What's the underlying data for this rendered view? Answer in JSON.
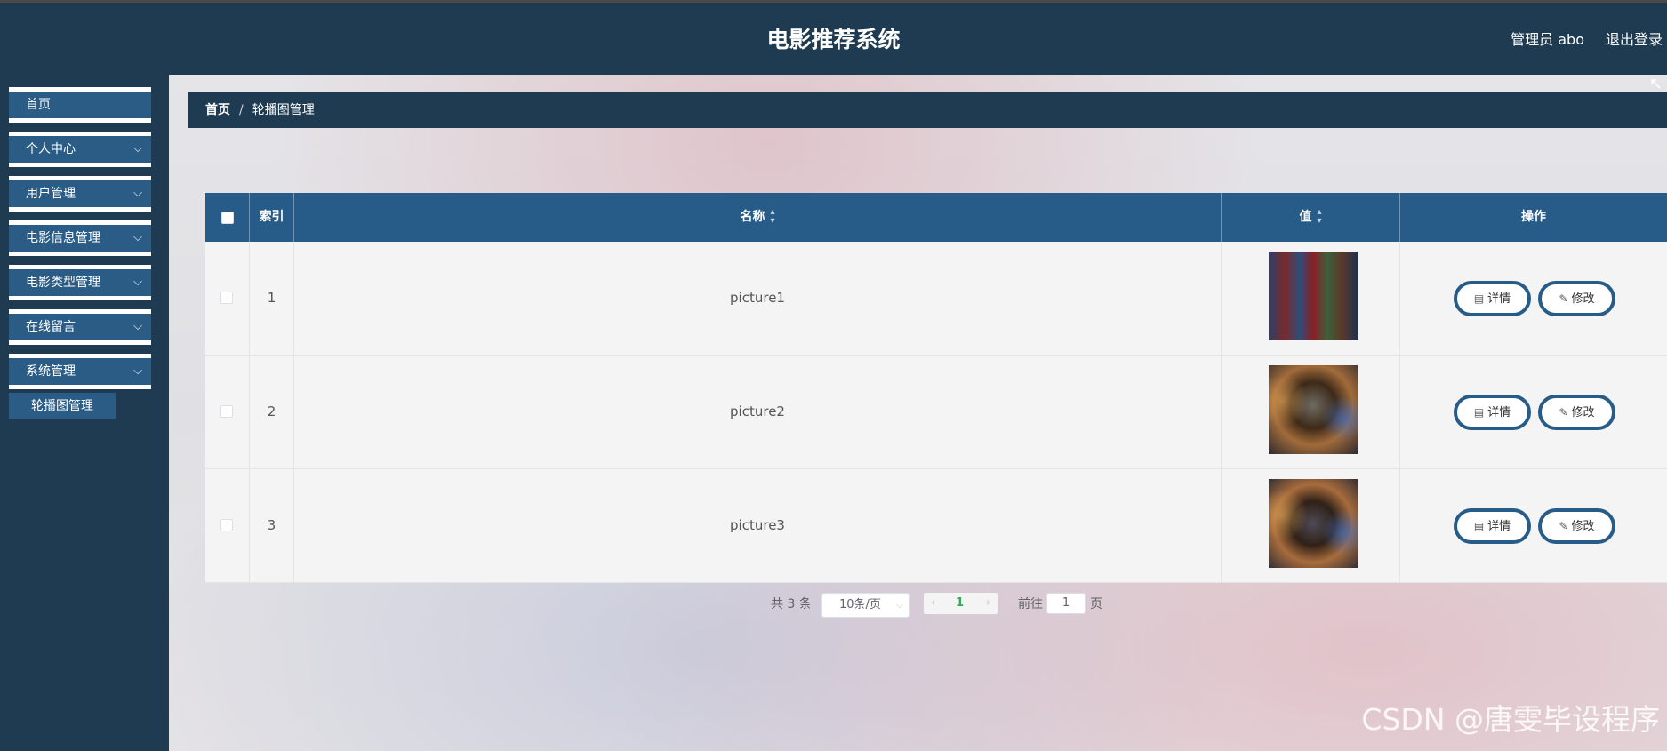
{
  "header": {
    "title": "电影推荐系统",
    "user_label": "管理员 abo",
    "logout_label": "退出登录"
  },
  "sidebar": {
    "items": [
      {
        "label": "首页"
      },
      {
        "label": "个人中心"
      },
      {
        "label": "用户管理"
      },
      {
        "label": "电影信息管理"
      },
      {
        "label": "电影类型管理"
      },
      {
        "label": "在线留言"
      },
      {
        "label": "系统管理"
      }
    ],
    "active_sub": "轮播图管理"
  },
  "breadcrumb": {
    "home": "首页",
    "sep": "/",
    "current": "轮播图管理"
  },
  "table": {
    "headers": {
      "index": "索引",
      "name": "名称",
      "value": "值",
      "action": "操作"
    },
    "rows": [
      {
        "index": "1",
        "name": "picture1"
      },
      {
        "index": "2",
        "name": "picture2"
      },
      {
        "index": "3",
        "name": "picture3"
      }
    ],
    "detail_label": "详情",
    "edit_label": "修改"
  },
  "pager": {
    "total": "共 3 条",
    "page_size": "10条/页",
    "current_page": "1",
    "goto_label": "前往",
    "goto_value": "1",
    "unit": "页"
  },
  "watermark": "CSDN @唐雯毕设程序"
}
